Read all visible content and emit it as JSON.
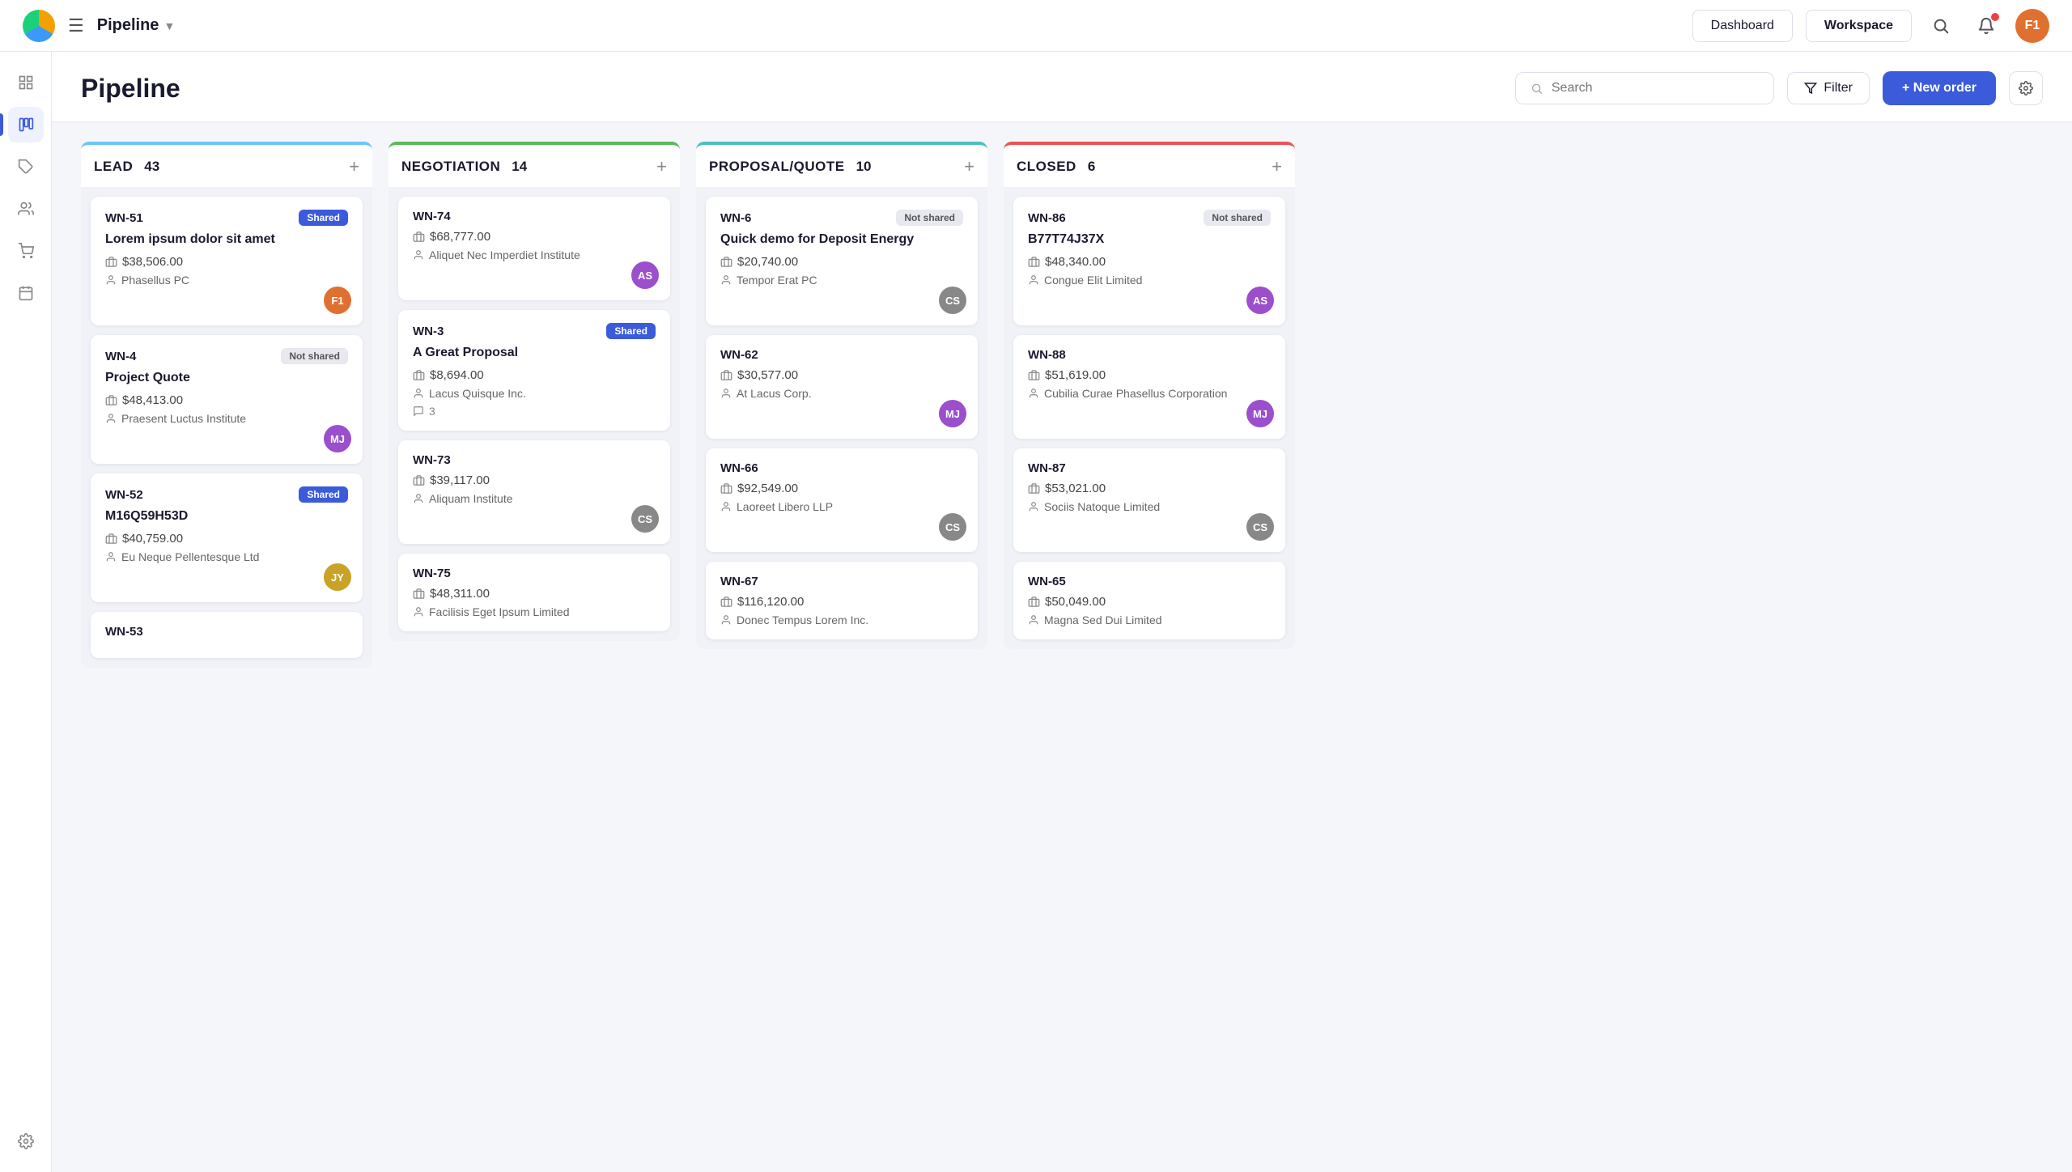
{
  "nav": {
    "pipeline_label": "Pipeline",
    "dashboard_label": "Dashboard",
    "workspace_label": "Workspace",
    "avatar_initials": "F1"
  },
  "page": {
    "title": "Pipeline",
    "search_placeholder": "Search",
    "filter_label": "Filter",
    "new_order_label": "+ New order"
  },
  "columns": [
    {
      "id": "lead",
      "title": "LEAD",
      "count": "43",
      "color_class": "lead-col",
      "cards": [
        {
          "id": "WN-51",
          "badge": "Shared",
          "badge_type": "shared",
          "name": "Lorem ipsum dolor sit amet",
          "amount": "$38,506.00",
          "company": "Phasellus PC",
          "avatar_initials": "F1",
          "avatar_class": "av-f1"
        },
        {
          "id": "WN-4",
          "badge": "Not shared",
          "badge_type": "not-shared",
          "name": "Project Quote",
          "amount": "$48,413.00",
          "company": "Praesent Luctus Institute",
          "avatar_initials": "MJ",
          "avatar_class": "av-mj"
        },
        {
          "id": "WN-52",
          "badge": "Shared",
          "badge_type": "shared",
          "name": "M16Q59H53D",
          "amount": "$40,759.00",
          "company": "Eu Neque Pellentesque Ltd",
          "avatar_initials": "JY",
          "avatar_class": "av-jy"
        },
        {
          "id": "WN-53",
          "badge": "",
          "badge_type": "",
          "name": "",
          "amount": "",
          "company": "",
          "avatar_initials": "",
          "avatar_class": ""
        }
      ]
    },
    {
      "id": "negotiation",
      "title": "NEGOTIATION",
      "count": "14",
      "color_class": "negotiation-col",
      "cards": [
        {
          "id": "WN-74",
          "badge": "",
          "badge_type": "",
          "name": "",
          "amount": "$68,777.00",
          "company": "Aliquet Nec Imperdiet Institute",
          "avatar_initials": "AS",
          "avatar_class": "av-as",
          "comment_count": ""
        },
        {
          "id": "WN-3",
          "badge": "Shared",
          "badge_type": "shared",
          "name": "A Great Proposal",
          "amount": "$8,694.00",
          "company": "Lacus Quisque Inc.",
          "avatar_initials": "",
          "avatar_class": "",
          "comment_count": "3"
        },
        {
          "id": "WN-73",
          "badge": "",
          "badge_type": "",
          "name": "",
          "amount": "$39,117.00",
          "company": "Aliquam Institute",
          "avatar_initials": "CS",
          "avatar_class": "av-cs"
        },
        {
          "id": "WN-75",
          "badge": "",
          "badge_type": "",
          "name": "",
          "amount": "$48,311.00",
          "company": "Facilisis Eget Ipsum Limited",
          "avatar_initials": "",
          "avatar_class": ""
        }
      ]
    },
    {
      "id": "proposal",
      "title": "PROPOSAL/QUOTE",
      "count": "10",
      "color_class": "proposal-col",
      "cards": [
        {
          "id": "WN-6",
          "badge": "Not shared",
          "badge_type": "not-shared",
          "name": "Quick demo for Deposit Energy",
          "amount": "$20,740.00",
          "company": "Tempor Erat PC",
          "avatar_initials": "CS",
          "avatar_class": "av-cs"
        },
        {
          "id": "WN-62",
          "badge": "",
          "badge_type": "",
          "name": "",
          "amount": "$30,577.00",
          "company": "At Lacus Corp.",
          "avatar_initials": "MJ",
          "avatar_class": "av-mj"
        },
        {
          "id": "WN-66",
          "badge": "",
          "badge_type": "",
          "name": "",
          "amount": "$92,549.00",
          "company": "Laoreet Libero LLP",
          "avatar_initials": "CS",
          "avatar_class": "av-cs"
        },
        {
          "id": "WN-67",
          "badge": "",
          "badge_type": "",
          "name": "",
          "amount": "$116,120.00",
          "company": "Donec Tempus Lorem Inc.",
          "avatar_initials": "",
          "avatar_class": ""
        }
      ]
    },
    {
      "id": "closed",
      "title": "CLOSED",
      "count": "6",
      "color_class": "closed-col",
      "cards": [
        {
          "id": "WN-86",
          "badge": "Not shared",
          "badge_type": "not-shared",
          "name": "B77T74J37X",
          "amount": "$48,340.00",
          "company": "Congue Elit Limited",
          "avatar_initials": "AS",
          "avatar_class": "av-as"
        },
        {
          "id": "WN-88",
          "badge": "",
          "badge_type": "",
          "name": "",
          "amount": "$51,619.00",
          "company": "Cubilia Curae Phasellus Corporation",
          "avatar_initials": "MJ",
          "avatar_class": "av-mj"
        },
        {
          "id": "WN-87",
          "badge": "",
          "badge_type": "",
          "name": "",
          "amount": "$53,021.00",
          "company": "Sociis Natoque Limited",
          "avatar_initials": "CS",
          "avatar_class": "av-cs"
        },
        {
          "id": "WN-65",
          "badge": "",
          "badge_type": "",
          "name": "",
          "amount": "$50,049.00",
          "company": "Magna Sed Dui Limited",
          "avatar_initials": "",
          "avatar_class": ""
        }
      ]
    }
  ],
  "sidebar_icons": [
    "grid",
    "kanban",
    "tag",
    "people",
    "cart",
    "calendar",
    "settings"
  ],
  "labels": {
    "shared": "Shared",
    "not_shared": "Not shared"
  }
}
